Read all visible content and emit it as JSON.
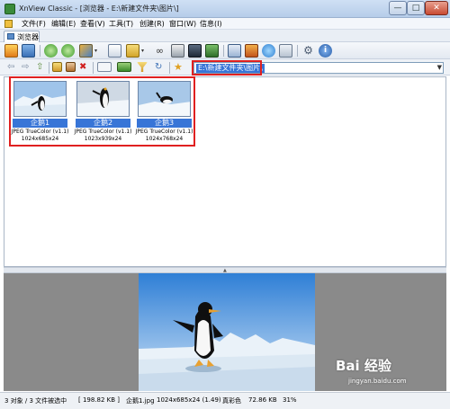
{
  "window": {
    "title": "XnView Classic - [浏览器 - E:\\新建文件夹\\图片\\]",
    "min": "—",
    "max": "□",
    "close": "✕"
  },
  "menu": [
    "文件(F)",
    "编辑(E)",
    "查看(V)",
    "工具(T)",
    "创建(R)",
    "窗口(W)",
    "信息(I)"
  ],
  "tab": {
    "label": "浏览器"
  },
  "toolbar": {
    "icons": [
      "browser-icon",
      "fullscreen-icon",
      "refresh-green-icon",
      "refresh-green-icon",
      "convert-icon",
      "dropdown-arrow-icon",
      "copy-icon",
      "open-icon",
      "dropdown-arrow-icon",
      "find-icon",
      "print-icon",
      "scanner-icon",
      "slideshow-icon",
      "capture-icon",
      "web-icon",
      "export-icon",
      "settings-icon",
      "info-icon"
    ],
    "nav_icons": [
      "back-icon",
      "forward-icon",
      "up-icon",
      "new-folder-icon",
      "edit-icon",
      "delete-icon",
      "view-mode-icon",
      "sort-icon",
      "filter-icon",
      "refresh-icon",
      "favorites-icon"
    ]
  },
  "path": {
    "value": "E:\\新建文件夹\\图片\\"
  },
  "thumbnails": [
    {
      "name": "企鹅1",
      "type": "JPEG TrueColor (v1.1)",
      "size": "1024x685x24"
    },
    {
      "name": "企鹅2",
      "type": "JPEG TrueColor (v1.1)",
      "size": "1023x939x24"
    },
    {
      "name": "企鹅3",
      "type": "JPEG TrueColor (v1.1)",
      "size": "1024x768x24"
    }
  ],
  "status": {
    "objects": "3 对象 / 3 文件被选中",
    "total_size": "[ 198.82 KB ]",
    "filename": "企鹅1.jpg",
    "dimensions": "1024x685x24 (1.49)",
    "color": "真彩色",
    "file_size": "72.86 KB",
    "zoom": "31%"
  },
  "watermark": {
    "text": "Bai 经验",
    "url": "jingyan.baidu.com"
  },
  "colors": {
    "selection": "#3875d7",
    "highlight": "#e02020",
    "titlebar": "#b6cde9"
  }
}
